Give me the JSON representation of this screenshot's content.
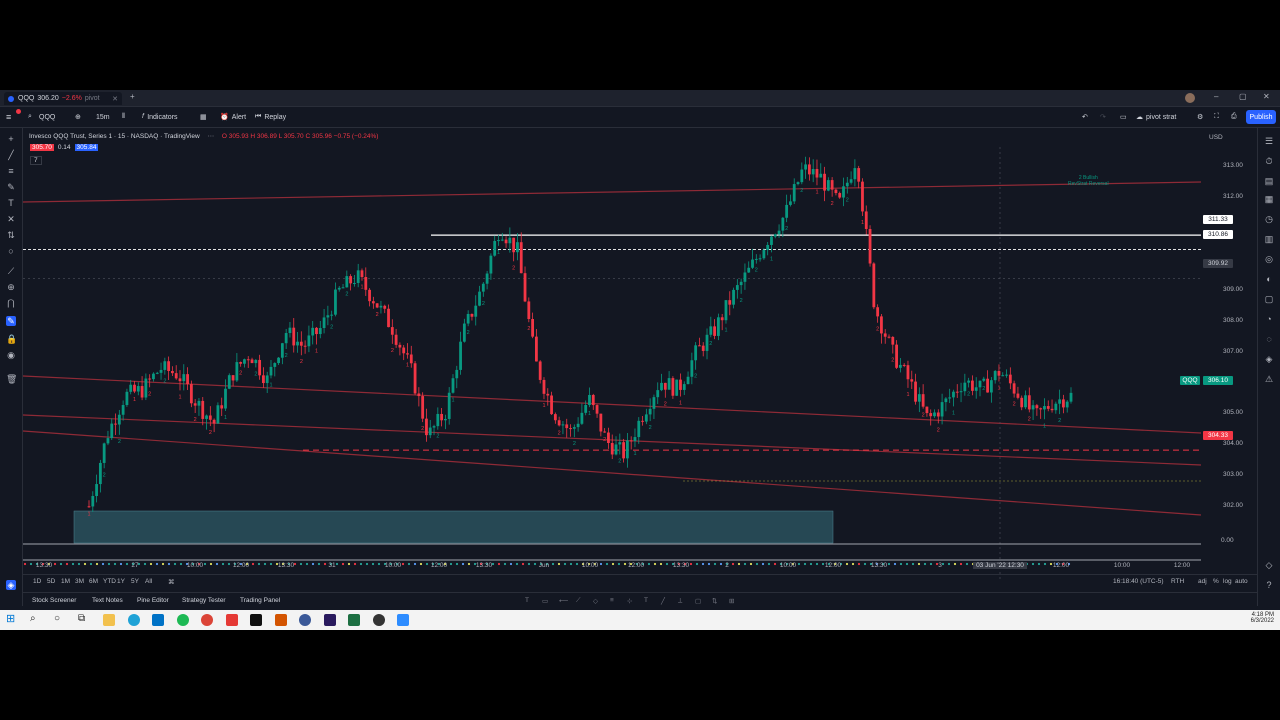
{
  "tab": {
    "symbol": "QQQ",
    "price": "306.20",
    "change": "−2.6%",
    "name": "pivot"
  },
  "toolbar": {
    "symbol": "QQQ",
    "interval": "15m",
    "indicators": "Indicators",
    "alert": "Alert",
    "replay": "Replay",
    "layout_name": "pivot strat",
    "publish": "Publish"
  },
  "legend": {
    "title": "Invesco QQQ Trust, Series 1 · 15 · NASDAQ · TradingView",
    "ohlc": "O 305.93 H 306.89 L 305.70 C 305.96 −0.75 (−0.24%)",
    "bid": "305.70",
    "spread": "0.14",
    "ask": "305.84",
    "indicator": "7"
  },
  "price_axis": {
    "currency": "USD",
    "ticks": [
      "313.00",
      "312.00",
      "311.00",
      "310.00",
      "309.00",
      "308.00",
      "307.00",
      "306.00",
      "305.00",
      "304.00",
      "303.00",
      "302.00"
    ],
    "label_white1": "311.33",
    "label_white2": "310.86",
    "label_crosshair": "309.92",
    "label_symbol": "QQQ",
    "label_last": "306.10",
    "label_red": "304.33",
    "label_osc": "0.00"
  },
  "annotations": {
    "reversal_line1": "2 Bullish",
    "reversal_line2": "RevStrat Reversal"
  },
  "time_axis": {
    "ticks": [
      "13:30",
      "27",
      "10:00",
      "12:00",
      "13:30",
      "31",
      "10:00",
      "12:00",
      "13:30",
      "Jun",
      "10:00",
      "12:00",
      "13:30",
      "2",
      "10:00",
      "12:00",
      "13:30",
      "3",
      "10:00",
      "12:00",
      "13:30",
      "6",
      "10:00",
      "12:00"
    ],
    "crosshair_date": "03 Jun '22",
    "crosshair_time": "12:30"
  },
  "range_bar": {
    "ranges": [
      "1D",
      "5D",
      "1M",
      "3M",
      "6M",
      "YTD",
      "1Y",
      "5Y",
      "All"
    ],
    "clock": "16:18:40 (UTC-5)",
    "session": "RTH",
    "adj": "adj",
    "pct": "%",
    "log": "log",
    "auto": "auto"
  },
  "bottom_tabs": [
    "Stock Screener",
    "Text Notes",
    "Pine Editor",
    "Strategy Tester",
    "Trading Panel"
  ],
  "taskbar": {
    "time": "4:18 PM",
    "date": "6/3/2022"
  },
  "colors": {
    "bg": "#131722",
    "up": "#26a69a",
    "down": "#ef5350",
    "accent": "#2962ff",
    "upbar": "#089981",
    "downbar": "#f23645"
  },
  "chart_data": {
    "type": "candlestick",
    "symbol": "QQQ",
    "interval": "15m",
    "ylim": [
      301.5,
      314.2
    ],
    "x": [
      "May 26 13:30",
      "May 27",
      "May 31",
      "Jun 1",
      "Jun 2",
      "Jun 3",
      "Jun 6"
    ],
    "close_series": [
      302.5,
      304.8,
      306.1,
      306.3,
      307.0,
      306.8,
      305.9,
      305.2,
      306.8,
      307.5,
      306.6,
      308.2,
      307.7,
      308.3,
      309.5,
      310.0,
      309.2,
      308.3,
      307.0,
      304.8,
      305.6,
      308.2,
      309.6,
      311.6,
      310.8,
      307.2,
      305.6,
      304.9,
      306.0,
      304.6,
      304.2,
      305.5,
      306.6,
      306.3,
      307.5,
      308.2,
      309.3,
      310.2,
      311.2,
      312.0,
      313.5,
      313.2,
      312.3,
      313.9,
      309.0,
      307.5,
      306.5,
      305.3,
      305.9,
      306.6,
      306.3,
      306.9,
      306.2,
      305.4,
      305.9,
      306.1
    ],
    "last_price": 306.1,
    "levels": [
      311.33,
      310.86,
      304.33
    ]
  }
}
